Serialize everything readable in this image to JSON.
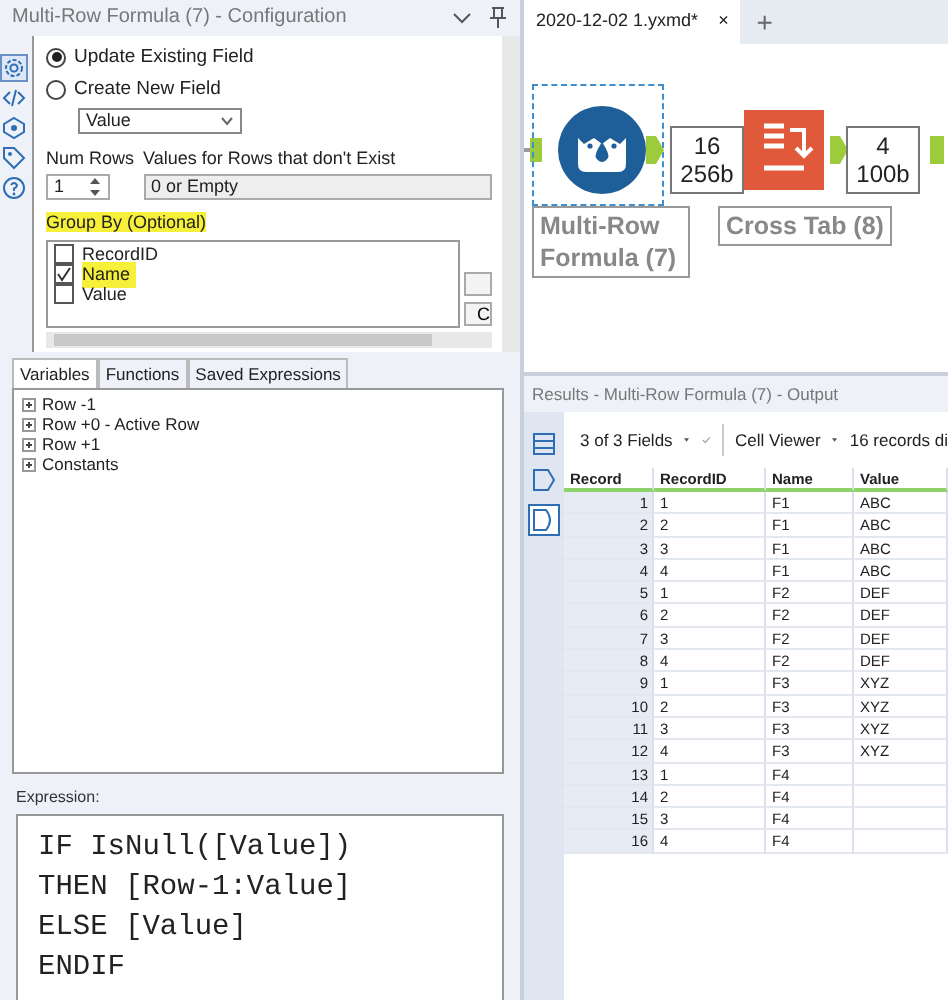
{
  "config": {
    "title": "Multi-Row Formula (7) - Configuration",
    "side_icons": [
      {
        "kind": "gear",
        "selected": true
      },
      {
        "kind": "code",
        "selected": false
      },
      {
        "kind": "hex",
        "selected": false
      },
      {
        "kind": "tag",
        "selected": false
      },
      {
        "kind": "help",
        "selected": false
      }
    ],
    "field_mode": [
      {
        "label": "Update Existing Field",
        "selected": true
      },
      {
        "label": "Create New  Field",
        "selected": false
      }
    ],
    "field_dropdown": {
      "value": "Value"
    },
    "num_rows": {
      "label": "Num Rows",
      "value": "1"
    },
    "missing_rows": {
      "label": "Values for Rows that don't Exist",
      "value": "0 or Empty"
    },
    "group_by": {
      "label": "Group By (Optional)",
      "highlighted": true,
      "fields": [
        {
          "label": "RecordID",
          "checked": false,
          "highlighted": false
        },
        {
          "label": "Name",
          "checked": true,
          "highlighted": true
        },
        {
          "label": "Value",
          "checked": false,
          "highlighted": false
        }
      ]
    },
    "side_buttons": [
      {
        "kind": "blank"
      },
      {
        "kind": "labeled",
        "label": "C"
      }
    ],
    "tabs": [
      {
        "label": "Variables",
        "selected": true
      },
      {
        "label": "Functions",
        "selected": false
      },
      {
        "label": "Saved Expressions",
        "selected": false
      }
    ],
    "variables": [
      {
        "label": "Row -1",
        "expanded": false
      },
      {
        "label": "Row +0 - Active Row",
        "expanded": false
      },
      {
        "label": "Row +1",
        "expanded": false
      },
      {
        "label": "Constants",
        "expanded": false
      }
    ],
    "expression": {
      "label": "Expression:",
      "lines": [
        "IF IsNull([Value])",
        "THEN [Row-1:Value]",
        "ELSE [Value]",
        "ENDIF"
      ]
    }
  },
  "workflow": {
    "tab": {
      "label": "2020-12-02 1.yxmd*",
      "close": "×"
    },
    "new_tab": "+",
    "nodes": [
      {
        "kind": "multirow",
        "label": "Multi-Row Formula (7)",
        "selected": true,
        "badge": [
          "16",
          "256b"
        ]
      },
      {
        "kind": "crosstab",
        "label": "Cross Tab (8)",
        "selected": false,
        "badge": [
          "4",
          "100b"
        ]
      }
    ]
  },
  "results": {
    "title": "Results - Multi-Row Formula (7) - Output",
    "fields": "3 of 3 Fields",
    "viewer": "Cell Viewer",
    "count": "16 records di",
    "columns": [
      "Record",
      "RecordID",
      "Name",
      "Value"
    ],
    "rows": [
      [
        "1",
        "1",
        "F1",
        "ABC"
      ],
      [
        "2",
        "2",
        "F1",
        "ABC"
      ],
      [
        "3",
        "3",
        "F1",
        "ABC"
      ],
      [
        "4",
        "4",
        "F1",
        "ABC"
      ],
      [
        "5",
        "1",
        "F2",
        "DEF"
      ],
      [
        "6",
        "2",
        "F2",
        "DEF"
      ],
      [
        "7",
        "3",
        "F2",
        "DEF"
      ],
      [
        "8",
        "4",
        "F2",
        "DEF"
      ],
      [
        "9",
        "1",
        "F3",
        "XYZ"
      ],
      [
        "10",
        "2",
        "F3",
        "XYZ"
      ],
      [
        "11",
        "3",
        "F3",
        "XYZ"
      ],
      [
        "12",
        "4",
        "F3",
        "XYZ"
      ],
      [
        "13",
        "1",
        "F4",
        ""
      ],
      [
        "14",
        "2",
        "F4",
        ""
      ],
      [
        "15",
        "3",
        "F4",
        ""
      ],
      [
        "16",
        "4",
        "F4",
        ""
      ]
    ]
  }
}
